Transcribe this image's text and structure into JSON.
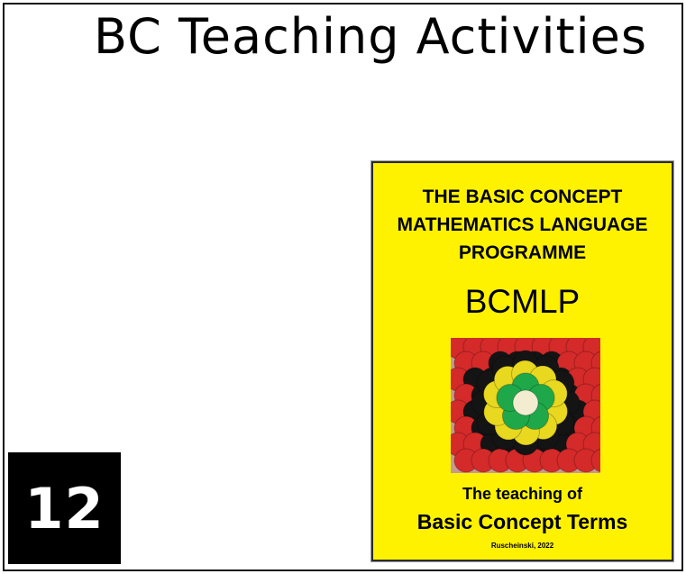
{
  "page": {
    "title": "BC Teaching Activities",
    "number": "12"
  },
  "cover": {
    "heading_line1": "THE BASIC CONCEPT",
    "heading_line2": "MATHEMATICS LANGUAGE",
    "heading_line3": "PROGRAMME",
    "acronym": "BCMLP",
    "subtitle": "The teaching of",
    "terms": "Basic Concept Terms",
    "author": "Ruscheinski, 2022",
    "art": {
      "icon": "counters-flower-pattern-image",
      "colors": {
        "background": "#c69a92",
        "outer_red": "#d42a2a",
        "black": "#141414",
        "yellow": "#e8d820",
        "green": "#1fa84a",
        "center": "#f2ecd0"
      }
    },
    "colors": {
      "background": "#fff200",
      "text": "#000000"
    }
  }
}
